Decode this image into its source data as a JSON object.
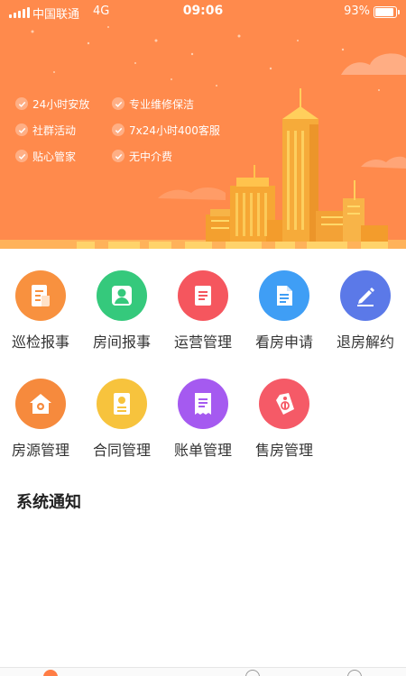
{
  "status_bar": {
    "carrier": "中国联通",
    "network": "4G",
    "time": "09:06",
    "battery": "93%"
  },
  "banner": {
    "features": [
      "24小时安放",
      "专业维修保洁",
      "社群活动",
      "7x24小时400客服",
      "贴心管家",
      "无中介费"
    ]
  },
  "menu": [
    {
      "label": "巡检报事",
      "icon": "document-icon",
      "color": "#f8913f"
    },
    {
      "label": "房间报事",
      "icon": "user-icon",
      "color": "#35c97c"
    },
    {
      "label": "运营管理",
      "icon": "list-icon",
      "color": "#f5565e"
    },
    {
      "label": "看房申请",
      "icon": "file-icon",
      "color": "#3f9ef5"
    },
    {
      "label": "退房解约",
      "icon": "pencil-icon",
      "color": "#5b79e8"
    },
    {
      "label": "房源管理",
      "icon": "house-icon",
      "color": "#f68a3d"
    },
    {
      "label": "合同管理",
      "icon": "contract-icon",
      "color": "#f7c33d"
    },
    {
      "label": "账单管理",
      "icon": "bill-icon",
      "color": "#a55af0"
    },
    {
      "label": "售房管理",
      "icon": "tag-icon",
      "color": "#f55a67"
    }
  ],
  "notice": {
    "title": "系统通知"
  },
  "colors": {
    "banner_bg": "#ff8a4c",
    "building": "#f6ab3a",
    "building_light": "#ffcf5c"
  }
}
